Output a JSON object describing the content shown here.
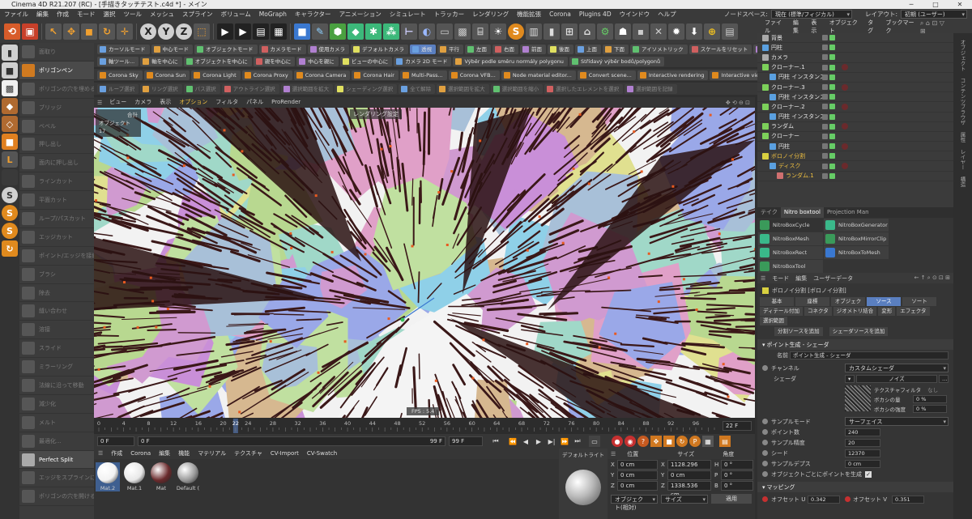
{
  "window": {
    "title": "Cinema 4D R21.207 (RC) - [手描きタッチテスト.c4d *] - メイン",
    "minimize": "─",
    "maximize": "□",
    "close": "✕"
  },
  "menu": {
    "items": [
      "ファイル",
      "編集",
      "作成",
      "モード",
      "選択",
      "ツール",
      "メッシュ",
      "スプライン",
      "ボリューム",
      "MoGraph",
      "キャラクター",
      "アニメーション",
      "シミュレート",
      "トラッカー",
      "レンダリング",
      "機能拡張",
      "Corona",
      "Plugins 4D",
      "ウインドウ",
      "ヘルプ"
    ],
    "nodespace_label": "ノードスペース:",
    "nodespace_value": "現在 (標準/フィジカル)",
    "layout_label": "レイアウト:",
    "layout_value": "初期 (ユーザー)"
  },
  "toolbar_axes": [
    "X",
    "Y",
    "Z"
  ],
  "mode_row1": [
    "カーソルモード",
    "中心モード",
    "オブジェクトモード",
    "カメラモード",
    "使用カメラ",
    "デフォルトカメラ",
    "透視",
    "平行",
    "左面",
    "右面",
    "前面",
    "後面",
    "上面",
    "下面",
    "アイソメトリック",
    "スケールをリセット",
    "PSRをリセット"
  ],
  "mode_row2": [
    "軸ツール...",
    "軸を中心に",
    "オブジェクトを中心に",
    "親を中心に",
    "中心を親に",
    "ビューの中心に",
    "カメラ 2D モード",
    "Výběr podle směru normály polygonu",
    "Střídavý výběr bodů/polygonů"
  ],
  "mode_row3": [
    "Corona Sky",
    "Corona Sun",
    "Corona Light",
    "Corona Proxy",
    "Corona Camera",
    "Corona Hair",
    "Multi-Pass...",
    "Corona VFB...",
    "Node material editor...",
    "Convert scene...",
    "Interactive rendering",
    "Interactive viewport"
  ],
  "mode_row4": [
    "ループ選択",
    "リング選択",
    "パス選択",
    "アウトライン選択",
    "選択範囲を拡大",
    "シェーディング選択",
    "全て解除",
    "選択範囲を拡大",
    "選択範囲を縮小",
    "選択したエレメントを選択",
    "選択範囲を記録"
  ],
  "left_tools": [
    "面取り",
    "ポリゴンペン",
    "ポリゴンの穴を埋める",
    "ブリッジ",
    "ベベル",
    "押し出し",
    "面内に押し出し",
    "ラインカット",
    "平面カット",
    "ループ/パスカット",
    "エッジカット",
    "ポイント/エッジを接続",
    "ブラシ",
    "除去",
    "縫い合わせ",
    "溶接",
    "スライド",
    "ミラーリング",
    "法線に沿って移動",
    "減少化",
    "メルト",
    "最適化...",
    "Perfect Split",
    "エッジをスプラインに",
    "ポリゴンの穴を開ける"
  ],
  "left_tools_active": [
    1,
    22
  ],
  "viewport": {
    "menu": [
      "ビュー",
      "カメラ",
      "表示",
      "オプション",
      "フィルタ",
      "パネル",
      "ProRender"
    ],
    "render_label": "レンダリング設定",
    "info_lines": [
      "合計",
      "オブジェクト  17"
    ],
    "fps": "FPS : 5.4"
  },
  "timeline": {
    "ticks": [
      "0",
      "4",
      "8",
      "12",
      "16",
      "20",
      "22",
      "24",
      "28",
      "32",
      "36",
      "40",
      "44",
      "48",
      "52",
      "56",
      "60",
      "64",
      "68",
      "72",
      "76",
      "80",
      "84",
      "88",
      "92",
      "96"
    ],
    "current": "22 F",
    "start": "0 F",
    "start2": "0 F",
    "end": "99 F",
    "end2": "99 F"
  },
  "material_manager": {
    "menu": [
      "作成",
      "Corona",
      "編集",
      "機能",
      "マテリアル",
      "テクスチャ",
      "CV-Import",
      "CV-Swatch"
    ],
    "materials": [
      {
        "name": "Mat.2",
        "color": "#f2f2f2"
      },
      {
        "name": "Mat.1",
        "color": "#e8e8e8"
      },
      {
        "name": "Mat",
        "color": "#6a2a2c"
      },
      {
        "name": "Default (",
        "color": "#9a9a9a"
      }
    ],
    "preview_label": "デフォルトライト"
  },
  "coords": {
    "headers": [
      "位置",
      "サイズ",
      "角度"
    ],
    "rows": [
      {
        "axis": "X",
        "pos": "0 cm",
        "size": "1128.296 cm",
        "rlabel": "H",
        "rot": "0 °"
      },
      {
        "axis": "Y",
        "pos": "0 cm",
        "size": "0 cm",
        "rlabel": "P",
        "rot": "0 °"
      },
      {
        "axis": "Z",
        "pos": "0 cm",
        "size": "1338.536 cm",
        "rlabel": "B",
        "rot": "0 °"
      }
    ],
    "mode1": "オブジェクト(相対)",
    "mode2": "サイズ",
    "apply": "適用"
  },
  "object_manager": {
    "menu": [
      "ファイル",
      "編集",
      "表示",
      "オブジェクト",
      "タグ",
      "ブックマーク"
    ],
    "objects": [
      {
        "name": "背景",
        "indent": 0,
        "color": "#aaa"
      },
      {
        "name": "円柱",
        "indent": 0,
        "color": "#5aa0e0"
      },
      {
        "name": "カメラ",
        "indent": 0,
        "color": "#aaa"
      },
      {
        "name": "クローナー.1",
        "indent": 0,
        "color": "#7cd05a"
      },
      {
        "name": "円柱 インスタンス",
        "indent": 1,
        "color": "#5aa0e0"
      },
      {
        "name": "クローナー.3",
        "indent": 0,
        "color": "#7cd05a"
      },
      {
        "name": "円柱 インスタンス",
        "indent": 1,
        "color": "#5aa0e0"
      },
      {
        "name": "クローナー.2",
        "indent": 0,
        "color": "#7cd05a"
      },
      {
        "name": "円柱 インスタンス",
        "indent": 1,
        "color": "#5aa0e0"
      },
      {
        "name": "ランダム",
        "indent": 0,
        "color": "#7cd05a"
      },
      {
        "name": "クローナー",
        "indent": 0,
        "color": "#7cd05a"
      },
      {
        "name": "円柱",
        "indent": 1,
        "color": "#5aa0e0"
      },
      {
        "name": "ボロノイ分割",
        "indent": 0,
        "color": "#d8d040",
        "highlight": true
      },
      {
        "name": "ディスク",
        "indent": 1,
        "color": "#5aa0e0",
        "highlight": true
      },
      {
        "name": "ランダム.1",
        "indent": 2,
        "color": "#d07070",
        "highlight": true
      }
    ]
  },
  "panel_tabs": [
    "テイク",
    "Nitro boxtool",
    "Projection Man"
  ],
  "panel_tab_active": 1,
  "nitro": [
    "NitroBoxCycle",
    "NitroBoxGenerator",
    "NitroBoxMesh",
    "NitroBoxMirrorClip",
    "NitroBoxRect",
    "NitroBoxToMesh",
    "NitroBoxTool"
  ],
  "attributes": {
    "menu": [
      "モード",
      "編集",
      "ユーザーデータ"
    ],
    "object_title": "ボロノイ分割 [ボロノイ分割]",
    "tabs_row1": [
      "基本",
      "座標",
      "オブジェクト",
      "ソース",
      "ソート"
    ],
    "tabs_row2": [
      "ディテール付加",
      "コネクタ",
      "ジオメトリ結合",
      "変形",
      "エフェクタ"
    ],
    "tabs_row3": [
      "選択範囲"
    ],
    "active_tab": "ソース",
    "buttons": [
      "分割ソースを追加",
      "シェーダソースを追加"
    ],
    "section_shader": "ポイント生成 - シェーダ",
    "name_label": "名前",
    "name_value": "ポイント生成 - シェーダ",
    "channel_label": "チャンネル",
    "channel_value": "カスタムシェーダ",
    "shader_label": "シェーダ",
    "shader_value": "ノイズ",
    "tex_filter_label": "テクスチャフィルタ",
    "tex_filter_value": "なし",
    "blur_offset_label": "ボカシの量",
    "blur_offset_value": "0 %",
    "blur_strength_label": "ボカシの強度",
    "blur_strength_value": "0 %",
    "sample_mode_label": "サンプルモード",
    "sample_mode_value": "サーフェイス",
    "points_label": "ポイント数",
    "points_value": "240",
    "precision_label": "サンプル精度",
    "precision_value": "20",
    "seed_label": "シード",
    "seed_value": "12370",
    "depth_label": "サンプルデプス",
    "depth_value": "0 cm",
    "per_object_label": "オブジェクトごとにポイントを生成",
    "section_mapping": "マッピング",
    "offset_u_label": "オフセット U",
    "offset_u_value": "0.342",
    "offset_v_label": "オフセット V",
    "offset_v_value": "0.351"
  },
  "right_side_tabs": [
    "オブジェクト",
    "コンテンツブラウザ",
    "属性",
    "レイヤー",
    "構造"
  ]
}
